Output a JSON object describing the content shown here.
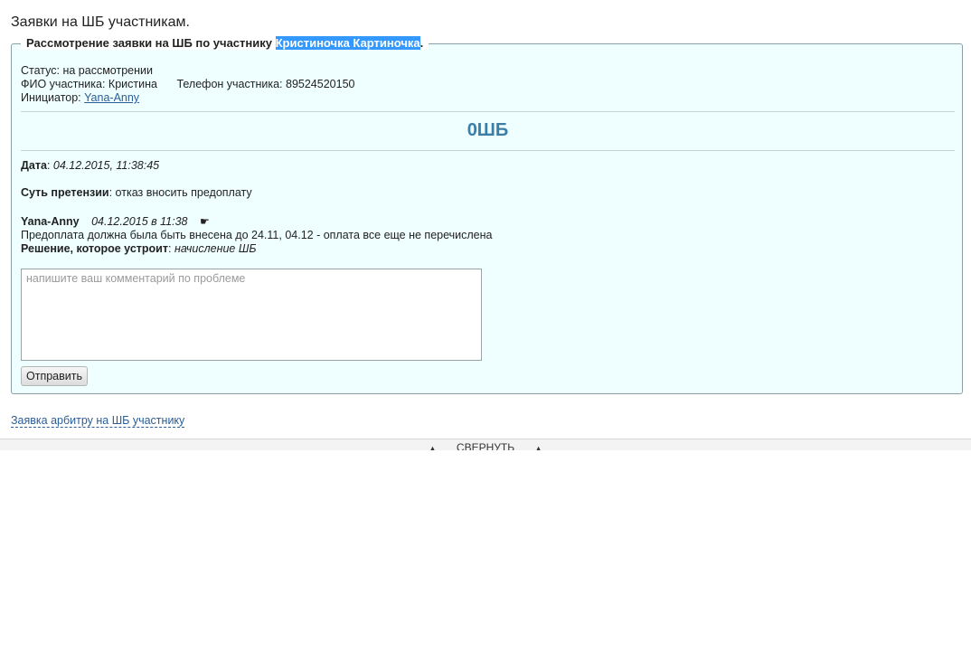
{
  "page": {
    "title": "Заявки на ШБ участникам."
  },
  "panel": {
    "legend_prefix": "Рассмотрение заявки на ШБ по участнику ",
    "legend_highlight": "Кристиночка Картиночка",
    "legend_suffix": ".",
    "status_label": "Статус:",
    "status_value": "на рассмотрении",
    "fio_label": "ФИО участника:",
    "fio_value": "Кристина",
    "phone_label": "Телефон участника:",
    "phone_value": "89524520150",
    "initiator_label": "Инициатор:",
    "initiator_link": "Yana-Anny",
    "amount": "0ШБ",
    "date_label": "Дата",
    "date_value": "04.12.2015, 11:38:45",
    "claim_label": "Суть претензии",
    "claim_value": "отказ вносить предоплату",
    "comment": {
      "author": "Yana-Anny",
      "date": "04.12.2015 в 11:38",
      "pointer": "☛",
      "text": "Предоплата должна была быть внесена до 24.11, 04.12 - оплата все еще не перечислена",
      "solution_label": "Решение, которое устроит",
      "solution_value": "начисление ШБ"
    },
    "textarea_placeholder": "напишите ваш комментарий по проблеме",
    "send_label": "Отправить"
  },
  "footer": {
    "arbiter_link": "Заявка арбитру на ШБ участнику",
    "collapse_label": "СВЕРНУТЬ",
    "collapse_arrow": "▲"
  }
}
